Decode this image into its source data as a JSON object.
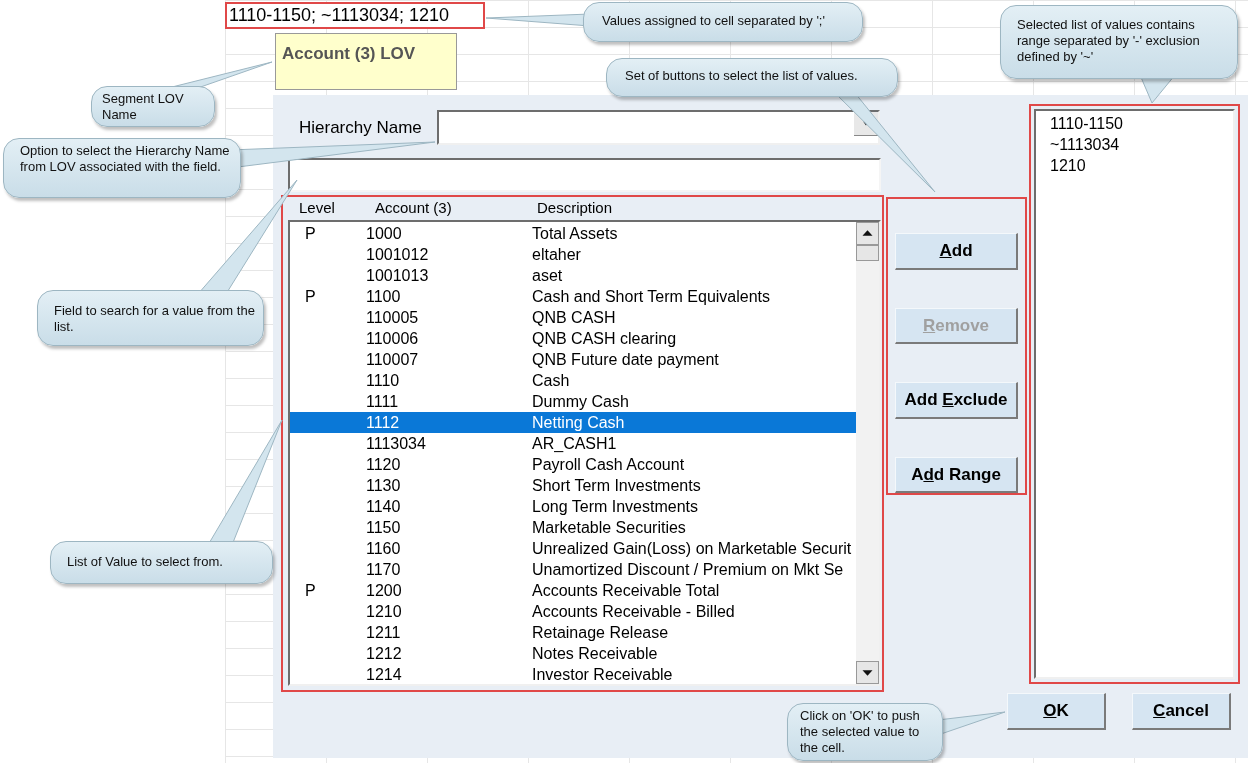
{
  "cell": {
    "value": "1110-1150; ~1113034; 1210"
  },
  "comment": {
    "title": "Account (3) LOV"
  },
  "dialog": {
    "hierarchy": {
      "label": "Hierarchy Name"
    },
    "list": {
      "columns": [
        "Level",
        "Account (3)",
        "Description"
      ],
      "rows": [
        {
          "level": "P",
          "account": "1000",
          "description": "Total Assets",
          "selected": false
        },
        {
          "account": "1001012",
          "description": "eltaher",
          "selected": false
        },
        {
          "account": "1001013",
          "description": "aset",
          "selected": false
        },
        {
          "level": "P",
          "account": "1100",
          "description": "Cash and Short Term Equivalents",
          "selected": false
        },
        {
          "account": "110005",
          "description": "QNB CASH",
          "selected": false
        },
        {
          "account": "110006",
          "description": "QNB CASH clearing",
          "selected": false
        },
        {
          "account": "110007",
          "description": "QNB Future date payment",
          "selected": false
        },
        {
          "account": "1110",
          "description": "Cash",
          "selected": false
        },
        {
          "account": "1111",
          "description": "Dummy Cash",
          "selected": false
        },
        {
          "account": "1112",
          "description": "Netting Cash",
          "selected": true
        },
        {
          "account": "1113034",
          "description": "AR_CASH1",
          "selected": false
        },
        {
          "account": "1120",
          "description": "Payroll Cash Account",
          "selected": false
        },
        {
          "account": "1130",
          "description": "Short Term Investments",
          "selected": false
        },
        {
          "account": "1140",
          "description": "Long Term Investments",
          "selected": false
        },
        {
          "account": "1150",
          "description": "Marketable Securities",
          "selected": false
        },
        {
          "account": "1160",
          "description": "Unrealized Gain(Loss) on Marketable Securit",
          "selected": false
        },
        {
          "account": "1170",
          "description": "Unamortized Discount / Premium on Mkt Se",
          "selected": false
        },
        {
          "level": "P",
          "account": "1200",
          "description": "Accounts Receivable Total",
          "selected": false
        },
        {
          "account": "1210",
          "description": "Accounts Receivable - Billed",
          "selected": false
        },
        {
          "account": "1211",
          "description": "Retainage Release",
          "selected": false
        },
        {
          "account": "1212",
          "description": "Notes Receivable",
          "selected": false
        },
        {
          "account": "1214",
          "description": "Investor Receivable",
          "selected": false
        }
      ]
    },
    "buttons": [
      {
        "key": "A",
        "post": "dd",
        "disabled": false
      },
      {
        "key": "R",
        "post": "emove",
        "disabled": true
      },
      {
        "pre": "Add ",
        "key": "E",
        "post": "xclude",
        "disabled": false
      },
      {
        "pre": "A",
        "key": "d",
        "post": "d Range",
        "disabled": false
      }
    ],
    "selected_values": [
      "1110-1150",
      "~1113034",
      "1210"
    ],
    "footer_buttons": [
      {
        "key": "O",
        "post": "K"
      },
      {
        "key": "C",
        "post": "ancel"
      }
    ]
  },
  "callouts": [
    {
      "text": "Values assigned to cell separated by ';'"
    },
    {
      "text": "Segment LOV Name"
    },
    {
      "text": "Option to select the Hierarchy Name from LOV associated with the field."
    },
    {
      "text": "Field to search for a value from the list."
    },
    {
      "text": "List of Value to select from."
    },
    {
      "text": "Set of buttons to select the list of values."
    },
    {
      "text": "Selected list of values contains range separated by '-' exclusion defined by '~'"
    },
    {
      "text": "Click on 'OK' to push the selected value to the cell."
    }
  ]
}
